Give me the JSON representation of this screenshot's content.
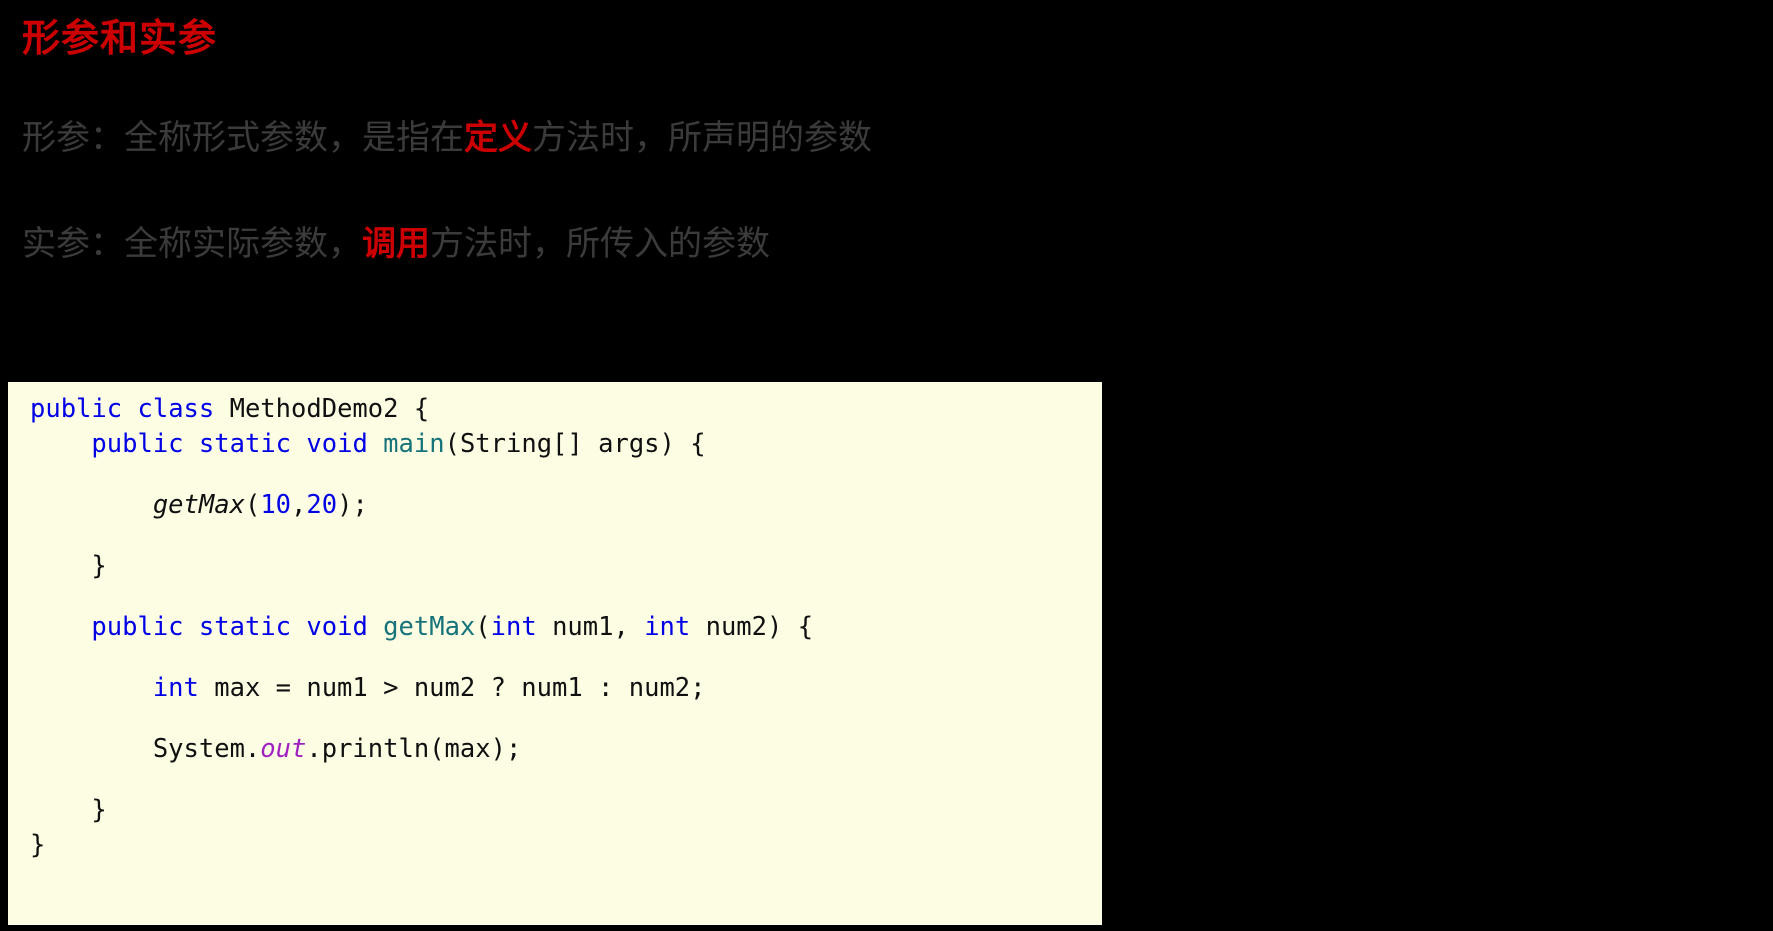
{
  "slide": {
    "title": "形参和实参",
    "title_color": "#cc0000",
    "background_color": "#000000",
    "body_text_color": "#3b3b3b",
    "highlight_color": "#cc0000"
  },
  "bullets": [
    {
      "id": "xingcan",
      "parts": [
        {
          "text": "形参：全称形式参数，是指在",
          "highlight": false
        },
        {
          "text": "定义",
          "highlight": true
        },
        {
          "text": "方法时，所声明的参数",
          "highlight": false
        }
      ],
      "plain": "形参：全称形式参数，是指在定义方法时，所声明的参数"
    },
    {
      "id": "shican",
      "parts": [
        {
          "text": "实参：全称实际参数，",
          "highlight": false
        },
        {
          "text": "调用",
          "highlight": true
        },
        {
          "text": "方法时，所传入的参数",
          "highlight": false
        }
      ],
      "plain": "实参：全称实际参数，调用方法时，所传入的参数"
    }
  ],
  "code_block": {
    "language": "java",
    "background_color": "#fdfde4",
    "filename_class": "MethodDemo2",
    "plain_text": "public class MethodDemo2 {\n    public static void main(String[] args) {\n\n        getMax(10,20);\n\n    }\n\n    public static void getMax(int num1, int num2) {\n\n        int max = num1 > num2 ? num1 : num2;\n\n        System.out.println(max);\n\n    }\n}",
    "lines": [
      {
        "blank": false,
        "tokens": [
          {
            "t": "public",
            "c": "kw"
          },
          {
            "t": " ",
            "c": "plain"
          },
          {
            "t": "class",
            "c": "kw"
          },
          {
            "t": " MethodDemo2 {",
            "c": "plain"
          }
        ]
      },
      {
        "blank": false,
        "tokens": [
          {
            "t": "    ",
            "c": "plain"
          },
          {
            "t": "public",
            "c": "kw"
          },
          {
            "t": " ",
            "c": "plain"
          },
          {
            "t": "static",
            "c": "kw"
          },
          {
            "t": " ",
            "c": "plain"
          },
          {
            "t": "void",
            "c": "kw"
          },
          {
            "t": " ",
            "c": "plain"
          },
          {
            "t": "main",
            "c": "method"
          },
          {
            "t": "(String[] args) {",
            "c": "plain"
          }
        ]
      },
      {
        "blank": true,
        "tokens": []
      },
      {
        "blank": false,
        "tokens": [
          {
            "t": "        ",
            "c": "plain"
          },
          {
            "t": "getMax",
            "c": "call"
          },
          {
            "t": "(",
            "c": "plain"
          },
          {
            "t": "10",
            "c": "num"
          },
          {
            "t": ",",
            "c": "plain"
          },
          {
            "t": "20",
            "c": "num"
          },
          {
            "t": ");",
            "c": "plain"
          }
        ]
      },
      {
        "blank": true,
        "tokens": []
      },
      {
        "blank": false,
        "tokens": [
          {
            "t": "    }",
            "c": "plain"
          }
        ]
      },
      {
        "blank": true,
        "tokens": []
      },
      {
        "blank": false,
        "tokens": [
          {
            "t": "    ",
            "c": "plain"
          },
          {
            "t": "public",
            "c": "kw"
          },
          {
            "t": " ",
            "c": "plain"
          },
          {
            "t": "static",
            "c": "kw"
          },
          {
            "t": " ",
            "c": "plain"
          },
          {
            "t": "void",
            "c": "kw"
          },
          {
            "t": " ",
            "c": "plain"
          },
          {
            "t": "getMax",
            "c": "method"
          },
          {
            "t": "(",
            "c": "plain"
          },
          {
            "t": "int",
            "c": "type"
          },
          {
            "t": " num1, ",
            "c": "plain"
          },
          {
            "t": "int",
            "c": "type"
          },
          {
            "t": " num2) {",
            "c": "plain"
          }
        ]
      },
      {
        "blank": true,
        "tokens": []
      },
      {
        "blank": false,
        "tokens": [
          {
            "t": "        ",
            "c": "plain"
          },
          {
            "t": "int",
            "c": "type"
          },
          {
            "t": " max = num1 > num2 ? num1 : num2;",
            "c": "plain"
          }
        ]
      },
      {
        "blank": true,
        "tokens": []
      },
      {
        "blank": false,
        "tokens": [
          {
            "t": "        System.",
            "c": "plain"
          },
          {
            "t": "out",
            "c": "field"
          },
          {
            "t": ".println(max);",
            "c": "plain"
          }
        ]
      },
      {
        "blank": true,
        "tokens": []
      },
      {
        "blank": false,
        "tokens": [
          {
            "t": "    }",
            "c": "plain"
          }
        ]
      },
      {
        "blank": false,
        "tokens": [
          {
            "t": "}",
            "c": "plain"
          }
        ]
      }
    ],
    "syntax_colors": {
      "keyword": "#0000e6",
      "type": "#0000e6",
      "number": "#0000e6",
      "method_declaration": "#16737a",
      "static_field": "#a020c0",
      "plain": "#101010"
    }
  }
}
